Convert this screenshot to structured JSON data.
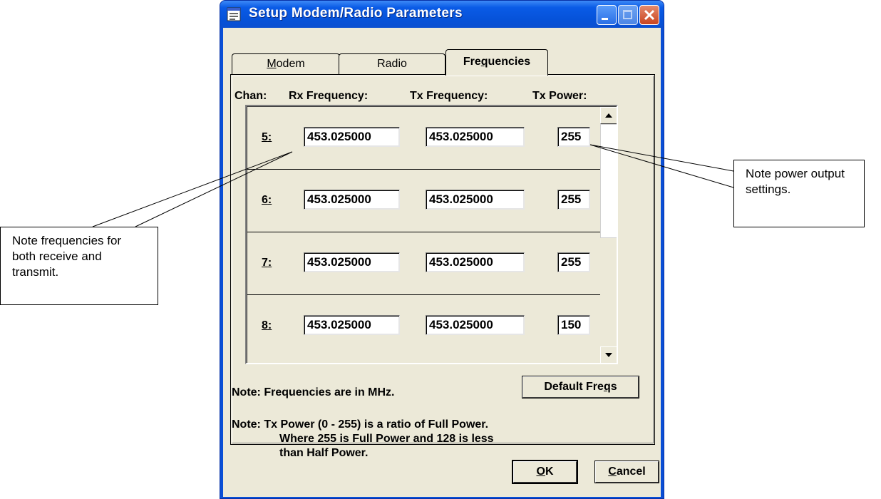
{
  "window": {
    "title": "Setup Modem/Radio Parameters",
    "controls": {
      "minimize": "minimize",
      "maximize": "maximize",
      "close": "close"
    }
  },
  "tabs": [
    {
      "label": "Modem",
      "mnemonic": "M",
      "rest": "odem",
      "active": false
    },
    {
      "label": "Radio",
      "active": false
    },
    {
      "label": "Frequencies",
      "pre": "Fre",
      "mnemonic": "q",
      "post": "uencies",
      "active": true
    }
  ],
  "headers": {
    "chan": "Chan:",
    "rx": "Rx Frequency:",
    "tx": "Tx Frequency:",
    "power": "Tx Power:"
  },
  "channels": [
    {
      "chan": "5",
      "rx": "453.025000",
      "tx": "453.025000",
      "power": "255"
    },
    {
      "chan": "6",
      "rx": "453.025000",
      "tx": "453.025000",
      "power": "255"
    },
    {
      "chan": "7",
      "rx": "453.025000",
      "tx": "453.025000",
      "power": "255"
    },
    {
      "chan": "8",
      "rx": "453.025000",
      "tx": "453.025000",
      "power": "150"
    }
  ],
  "notes": {
    "units": "Note: Frequencies are in MHz.",
    "power_line1": "Note: Tx Power (0 - 255) is a ratio of Full Power.",
    "power_line2": "Where 255 is Full Power and 128 is less",
    "power_line3": "than Half Power."
  },
  "buttons": {
    "default_pre": "Default Fre",
    "default_mn": "q",
    "default_post": "s",
    "ok_mn": "O",
    "ok_post": "K",
    "cancel_mn": "C",
    "cancel_post": "ancel"
  },
  "callouts": {
    "left": "Note frequencies for both receive and transmit.",
    "right": "Note power output settings."
  },
  "colors": {
    "titlebar": "#0a5be6",
    "dialog_face": "#ece9d8",
    "close_button": "#c9441f"
  }
}
